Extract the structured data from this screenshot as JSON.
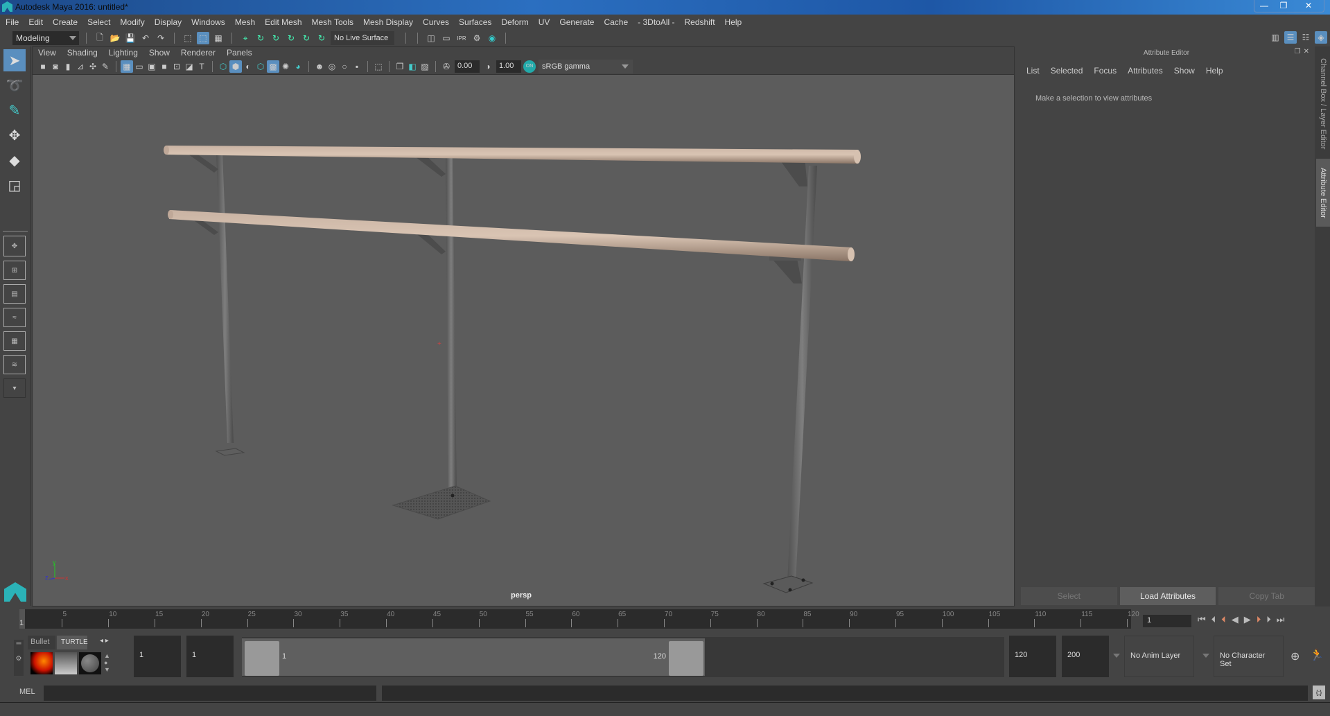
{
  "window": {
    "title": "Autodesk Maya 2016: untitled*",
    "minimize": "—",
    "restore": "❐",
    "close": "✕"
  },
  "menubar": [
    "File",
    "Edit",
    "Create",
    "Select",
    "Modify",
    "Display",
    "Windows",
    "Mesh",
    "Edit Mesh",
    "Mesh Tools",
    "Mesh Display",
    "Curves",
    "Surfaces",
    "Deform",
    "UV",
    "Generate",
    "Cache",
    "- 3DtoAll -",
    "Redshift",
    "Help"
  ],
  "shelf": {
    "mode": "Modeling",
    "live_surface": "No Live Surface"
  },
  "viewport": {
    "menu": [
      "View",
      "Shading",
      "Lighting",
      "Show",
      "Renderer",
      "Panels"
    ],
    "exposure": "0.00",
    "gamma": "1.00",
    "color_mgmt_toggle": "ON",
    "color_space": "sRGB gamma",
    "camera_label": "persp",
    "axis": {
      "x": "x",
      "y": "y",
      "z": "z"
    }
  },
  "attribute_editor": {
    "title": "Attribute Editor",
    "menu": [
      "List",
      "Selected",
      "Focus",
      "Attributes",
      "Show",
      "Help"
    ],
    "message": "Make a selection to view attributes",
    "buttons": {
      "select": "Select",
      "load": "Load Attributes",
      "copy": "Copy Tab"
    }
  },
  "side_tabs": {
    "channel_box": "Channel Box / Layer Editor",
    "attribute_editor": "Attribute Editor"
  },
  "timeline": {
    "start_label": "1",
    "ticks": [
      "5",
      "10",
      "15",
      "20",
      "25",
      "30",
      "35",
      "40",
      "45",
      "50",
      "55",
      "60",
      "65",
      "70",
      "75",
      "80",
      "85",
      "90",
      "95",
      "100",
      "105",
      "110",
      "115",
      "120"
    ],
    "current_frame": "1"
  },
  "range": {
    "shelf_tabs": [
      "Bullet",
      "TURTLE"
    ],
    "start_time": "1",
    "playback_start": "1",
    "range_start_label": "1",
    "range_end_label": "120",
    "playback_end": "120",
    "end_time": "200",
    "anim_layer": "No Anim Layer",
    "character_set": "No Character Set"
  },
  "command_line": {
    "label": "MEL",
    "value": "",
    "result": ""
  }
}
